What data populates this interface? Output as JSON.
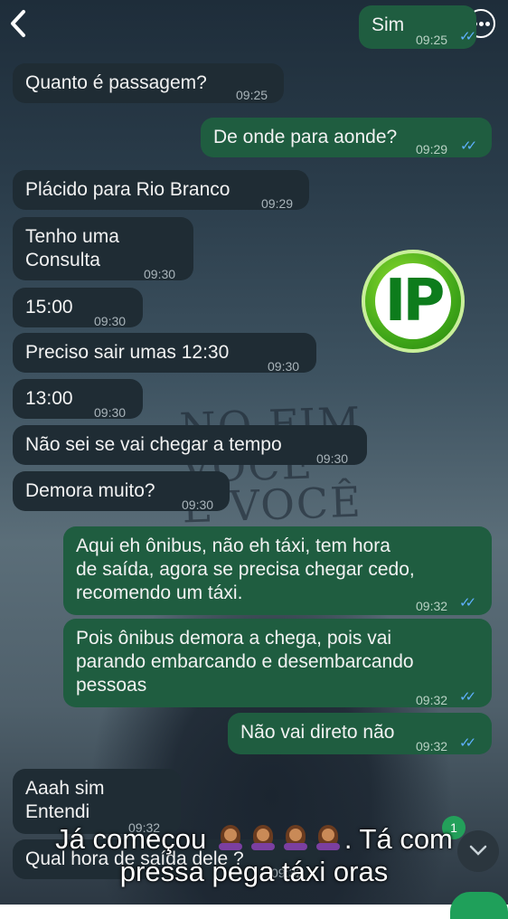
{
  "background_text": "NO FIM\nVOCÊ\nE VOCÊ",
  "logo": {
    "text": "IP",
    "colors": {
      "ring": "#3ea518",
      "letters": "#0d7c1c"
    }
  },
  "header": {
    "back_icon": "chevron-left-icon",
    "menu_icon": "more-options-icon"
  },
  "messages": [
    {
      "text": "Sim",
      "time": "09:25"
    },
    {
      "text": "Quanto é passagem?",
      "time": "09:25"
    },
    {
      "text": "De onde para aonde?",
      "time": "09:29"
    },
    {
      "text": "Plácido para Rio Branco",
      "time": "09:29"
    },
    {
      "text": "Tenho uma\nConsulta",
      "time": "09:30"
    },
    {
      "text": "15:00",
      "time": "09:30"
    },
    {
      "text": "Preciso sair umas  12:30",
      "time": "09:30"
    },
    {
      "text": "13:00",
      "time": "09:30"
    },
    {
      "text": "Não sei se vai chegar a tempo",
      "time": "09:30"
    },
    {
      "text": "Demora muito?",
      "time": "09:30"
    },
    {
      "text": "Aqui eh ônibus, não eh táxi, tem hora\nde saída, agora se precisa chegar cedo,\nrecomendo um táxi.",
      "time": "09:32"
    },
    {
      "text": "Pois ônibus demora a chega, pois vai\nparando embarcando e desembarcando\npessoas",
      "time": "09:32"
    },
    {
      "text": "Não vai direto não",
      "time": "09:32"
    },
    {
      "text": "Aaah sim\nEntendi",
      "time": "09:32"
    },
    {
      "text": "Qual hora de saída dele ?",
      "time": "09:32"
    }
  ],
  "caption": {
    "line1_a": "Já começou",
    "line1_b": ". Tá com",
    "line2": "pressa pega táxi oras"
  },
  "unread_badge": "1",
  "colors": {
    "incoming": "#1f2c34",
    "outgoing": "#1f5d40",
    "read_ticks": "#5fb0ff"
  }
}
